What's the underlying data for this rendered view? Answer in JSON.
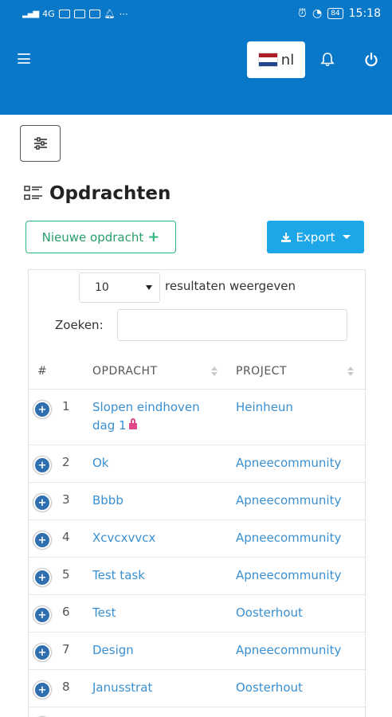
{
  "status_bar": {
    "network": "4G",
    "time": "15:18",
    "battery": "84"
  },
  "header": {
    "language_code": "nl",
    "flag_colors": [
      "#ae1c28",
      "#ffffff",
      "#21468b"
    ]
  },
  "page": {
    "title": "Opdrachten"
  },
  "actions": {
    "new_label": "Nieuwe opdracht",
    "new_plus": "+",
    "export_label": "Export"
  },
  "table_controls": {
    "page_length": "10",
    "page_length_label": "resultaten weergeven",
    "search_label": "Zoeken:",
    "search_value": ""
  },
  "table": {
    "columns": [
      "#",
      "OPDRACHT",
      "PROJECT"
    ],
    "rows": [
      {
        "num": "1",
        "task": "Slopen eindhoven dag 1",
        "project": "Heinheun",
        "locked": true
      },
      {
        "num": "2",
        "task": "Ok",
        "project": "Apneecommunity"
      },
      {
        "num": "3",
        "task": "Bbbb",
        "project": "Apneecommunity"
      },
      {
        "num": "4",
        "task": "Xcvcxvvcx",
        "project": "Apneecommunity"
      },
      {
        "num": "5",
        "task": "Test task",
        "project": "Apneecommunity"
      },
      {
        "num": "6",
        "task": "Test",
        "project": "Oosterhout"
      },
      {
        "num": "7",
        "task": "Design",
        "project": "Apneecommunity"
      },
      {
        "num": "8",
        "task": "Janusstrat",
        "project": "Oosterhout"
      }
    ]
  },
  "colors": {
    "primary": "#0a78c8",
    "success": "#2fb67c",
    "info": "#1ea7e8",
    "link": "#3a8fd0",
    "lock": "#e0478a"
  }
}
